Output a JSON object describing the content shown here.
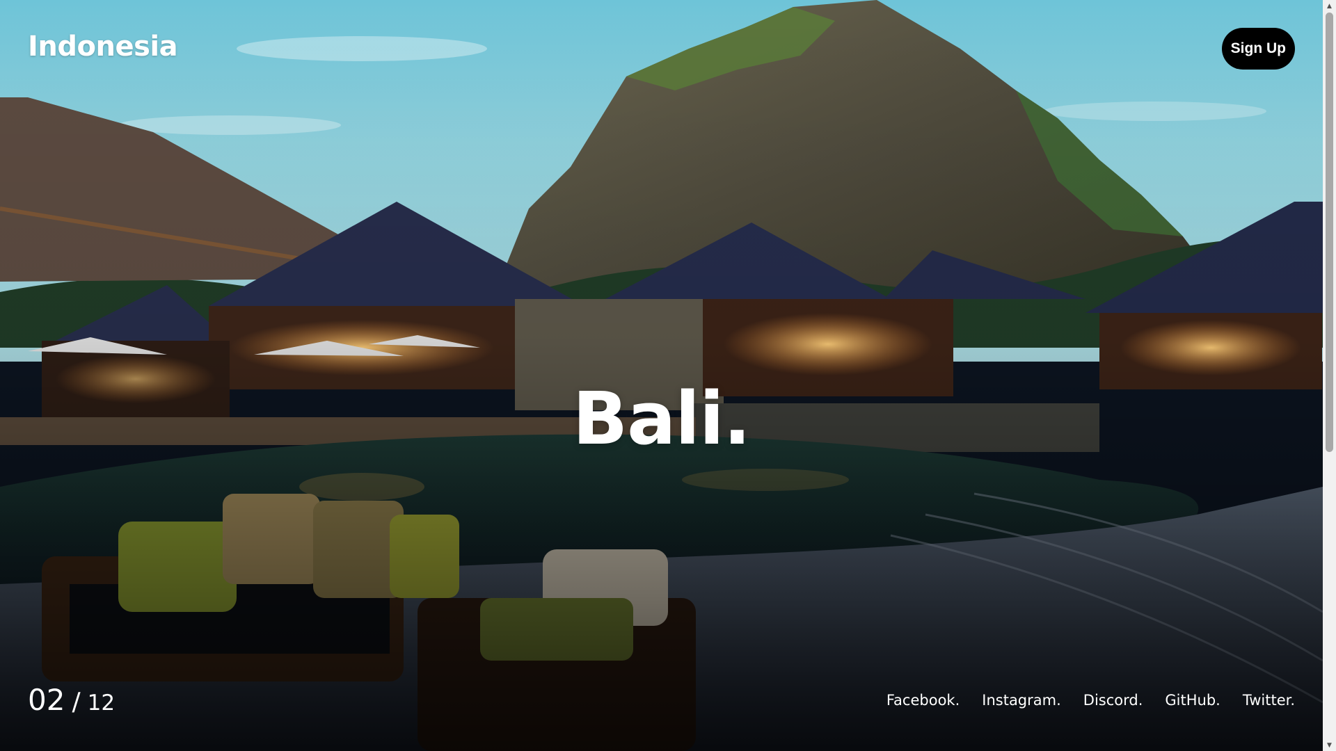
{
  "header": {
    "brand": "Indonesia",
    "signup_label": "Sign Up"
  },
  "hero": {
    "title": "Bali.",
    "image_icon": "resort-photo"
  },
  "pager": {
    "current": "02",
    "separator": "/",
    "total": "12"
  },
  "socials": [
    "Facebook.",
    "Instagram.",
    "Discord.",
    "GitHub.",
    "Twitter."
  ],
  "scrollbar": {
    "up_icon": "triangle-up",
    "down_icon": "triangle-down",
    "position": 0
  },
  "colors": {
    "button_bg": "#000000",
    "text": "#ffffff"
  }
}
